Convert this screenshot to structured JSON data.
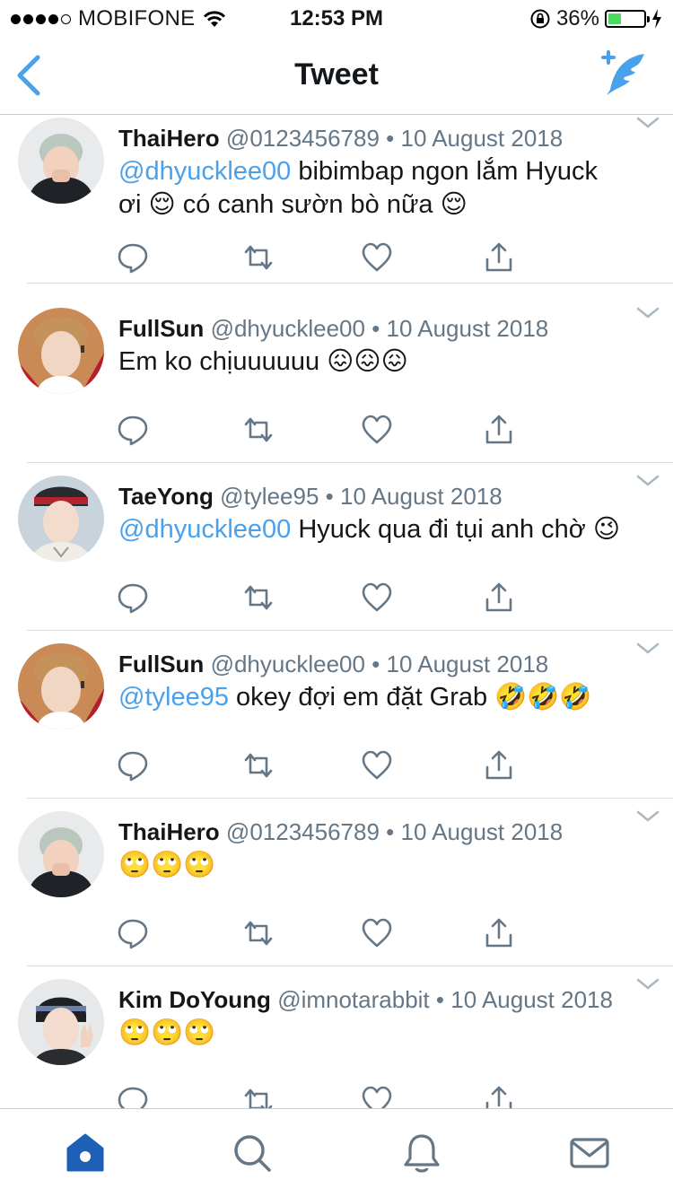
{
  "status_bar": {
    "carrier": "MOBIFONE",
    "time": "12:53 PM",
    "battery": "36%",
    "battery_level": 0.36,
    "battery_color": "#4cd964"
  },
  "nav": {
    "title": "Tweet",
    "back_icon": "chevron-left-icon",
    "compose_icon": "compose-feather-icon",
    "accent": "#4aa1eb"
  },
  "tweets": [
    {
      "name": "ThaiHero",
      "handle": "@0123456789",
      "sep": "•",
      "date": "10 August 2018",
      "mention": "@dhyucklee00",
      "line1": " bibimbap ngon lắm Hyuck",
      "line2": "ơi 😌 có canh sườn bò nữa 😌"
    },
    {
      "name": "FullSun",
      "handle": "@dhyucklee00",
      "sep": "•",
      "date": "10 August 2018",
      "mention": "",
      "line1": "Em ko chịuuuuuu 😖😖😖",
      "line2": ""
    },
    {
      "name": "TaeYong",
      "handle": "@tylee95",
      "sep": "•",
      "date": "10 August 2018",
      "mention": "@dhyucklee00",
      "line1": " Hyuck qua đi tụi anh chờ 😉",
      "line2": ""
    },
    {
      "name": "FullSun",
      "handle": "@dhyucklee00",
      "sep": "•",
      "date": "10 August 2018",
      "mention": "@tylee95",
      "line1": " okey đợi em đặt Grab 🤣🤣🤣",
      "line2": ""
    },
    {
      "name": "ThaiHero",
      "handle": "@0123456789",
      "sep": "•",
      "date": "10 August 2018",
      "mention": "",
      "line1": "🙄🙄🙄",
      "line2": ""
    },
    {
      "name": "Kim DoYoung",
      "handle": "@imnotarabbit",
      "sep": "•",
      "date": "10 August 2018",
      "mention": "",
      "line1": "🙄🙄🙄",
      "line2": ""
    }
  ],
  "action_icons": [
    "reply-icon",
    "retweet-icon",
    "like-icon",
    "share-icon"
  ],
  "tab_bar": {
    "tabs": [
      "home-icon",
      "search-icon",
      "notifications-icon",
      "messages-icon"
    ],
    "active_color": "#1d60b5",
    "inactive_color": "#657786"
  }
}
